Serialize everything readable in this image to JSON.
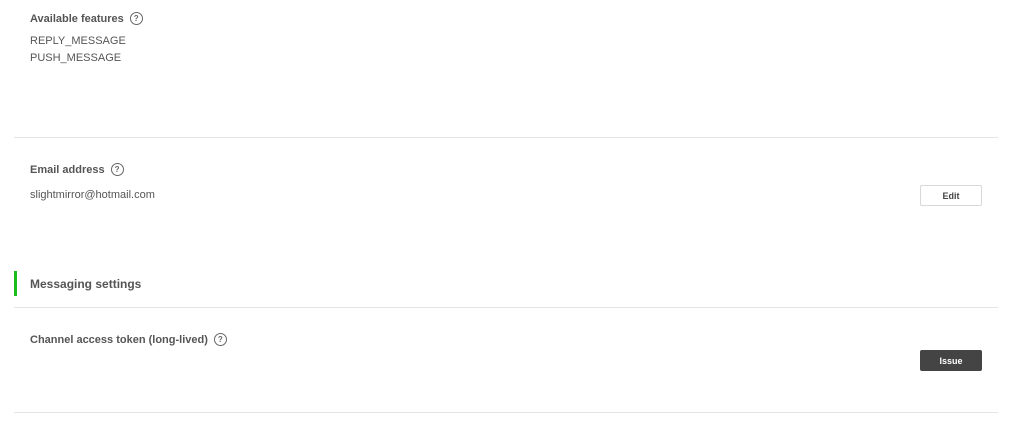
{
  "features": {
    "label": "Available features",
    "help_icon": "?",
    "items": [
      "REPLY_MESSAGE",
      "PUSH_MESSAGE"
    ]
  },
  "email": {
    "label": "Email address",
    "help_icon": "?",
    "value": "slightmirror@hotmail.com",
    "edit_label": "Edit"
  },
  "messaging": {
    "heading": "Messaging settings",
    "accent_color": "#1dbd1d"
  },
  "token": {
    "label": "Channel access token (long-lived)",
    "help_icon": "?",
    "issue_label": "Issue"
  }
}
